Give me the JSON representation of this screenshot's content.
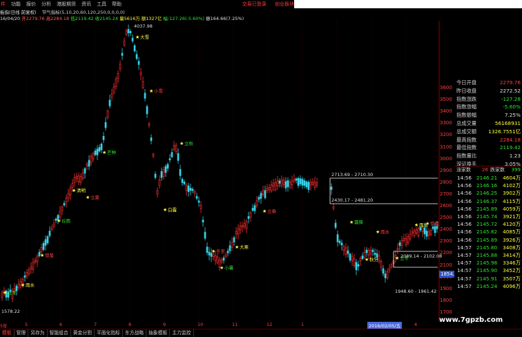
{
  "menu": [
    "件",
    "功能",
    "报价",
    "分析",
    "港股期货",
    "资讯",
    "工具",
    "帮助"
  ],
  "top_links": [
    "交易已登录",
    "创业板块"
  ],
  "title": {
    "name": "板指(日线 前复权)",
    "indicator": "节气指标(5,10,20,60,120,250,0,0,0,0)"
  },
  "info_line": {
    "date": "16/04/20",
    "open": "开2279.76",
    "high": "高2284.18",
    "low": "低2119.42",
    "close": "收2145.24",
    "volume": "量5616万",
    "amount": "额1327亿",
    "change": "幅-127.26(-5.60%)",
    "amplitude": "振164.66(7.25%)"
  },
  "chart": {
    "annotations": [
      {
        "label": "4037.98"
      },
      {
        "label": "1578.22"
      },
      {
        "label": "2713.69 - 2710.30"
      },
      {
        "label": "2430.17 - 2481.20"
      },
      {
        "label": "2089.14 - 2102.08"
      },
      {
        "label": "1948.60 - 1961.42"
      }
    ],
    "solar_terms": [
      "立冬",
      "雨水",
      "惊蛰",
      "谷雨",
      "清明",
      "立夏",
      "芒种",
      "大雪",
      "小雪",
      "立秋",
      "白露",
      "冬至",
      "小暑",
      "大寒",
      "立春",
      "霜降",
      "秋分",
      "雨水"
    ],
    "y_axis": [
      "3600",
      "3500",
      "3400",
      "3300",
      "3200",
      "3100",
      "3000",
      "2900",
      "2800",
      "2700",
      "2600",
      "2500",
      "2400",
      "2300",
      "2200",
      "2100",
      "2000",
      "1900",
      "1800",
      "1700"
    ],
    "current_price": "1854.6",
    "x_axis": [
      "5年",
      "5",
      "6",
      "7",
      "8",
      "9",
      "10",
      "11",
      "12",
      "1",
      "2016/02/05/五",
      "4"
    ]
  },
  "quote_panel": {
    "rows": [
      {
        "label": "今日开盘",
        "value": "2279.76",
        "color": "#ff4040"
      },
      {
        "label": "昨日收盘",
        "value": "2272.52",
        "color": "#e0e0e0"
      },
      {
        "label": "指数涨跌",
        "value": "-127.28",
        "color": "#2ee62e"
      },
      {
        "label": "指数涨幅",
        "value": "-5.60%",
        "color": "#2ee62e"
      },
      {
        "label": "指数振幅",
        "value": "7.25%",
        "color": "#e0e0e0"
      },
      {
        "label": "总成交量",
        "value": "56168931",
        "color": "#ffff40"
      },
      {
        "label": "总成交额",
        "value": "1326.7551亿",
        "color": "#ffff40"
      },
      {
        "label": "最高指数",
        "value": "2284.18",
        "color": "#ff4040"
      },
      {
        "label": "最低指数",
        "value": "2119.42",
        "color": "#2ee62e"
      },
      {
        "label": "指数量比",
        "value": "1.23",
        "color": "#e0e0e0"
      },
      {
        "label": "深证换手",
        "value": "3.05%",
        "color": "#e0e0e0"
      }
    ],
    "stats": {
      "up_label": "涨家数",
      "up_value": "26",
      "down_label": "跌家数",
      "down_value": "399"
    },
    "ticks": [
      {
        "time": "14:56",
        "price": "2146.21",
        "vol": "4604万"
      },
      {
        "time": "14:56",
        "price": "2146.16",
        "vol": "4102万"
      },
      {
        "time": "14:56",
        "price": "2146.25",
        "vol": "3902万"
      },
      {
        "time": "14:56",
        "price": "2146.37",
        "vol": "4115万"
      },
      {
        "time": "14:56",
        "price": "2145.89",
        "vol": "4059万"
      },
      {
        "time": "14:56",
        "price": "2145.74",
        "vol": "3921万"
      },
      {
        "time": "14:56",
        "price": "2145.72",
        "vol": "4120万"
      },
      {
        "time": "14:56",
        "price": "2145.82",
        "vol": "4085万"
      },
      {
        "time": "14:56",
        "price": "2145.89",
        "vol": "3926万"
      },
      {
        "time": "14:57",
        "price": "2145.80",
        "vol": "3408万"
      },
      {
        "time": "14:57",
        "price": "2145.88",
        "vol": "3414万"
      },
      {
        "time": "14:57",
        "price": "2145.98",
        "vol": "3346万"
      },
      {
        "time": "14:57",
        "price": "2145.90",
        "vol": "3452万"
      },
      {
        "time": "14:57",
        "price": "2145.91",
        "vol": "3507万"
      },
      {
        "time": "14:57",
        "price": "2145.24",
        "vol": "4096万"
      }
    ]
  },
  "bottom_tabs": [
    "模板",
    "管理",
    "另存为",
    "智能组合",
    "黄金分割",
    "平面化指标",
    "东方战略",
    "抽象模板",
    "主力监控"
  ],
  "watermark": "www.7gpzb.com"
}
